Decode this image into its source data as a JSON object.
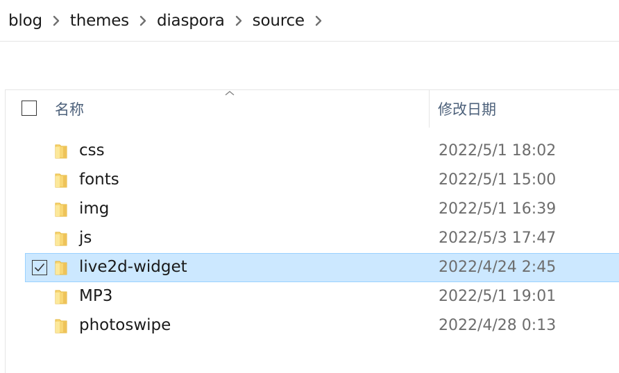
{
  "breadcrumb": {
    "items": [
      {
        "label": "blog"
      },
      {
        "label": "themes"
      },
      {
        "label": "diaspora"
      },
      {
        "label": "source"
      }
    ]
  },
  "header": {
    "name_label": "名称",
    "date_label": "修改日期",
    "sort_icon": "chevron-up-icon"
  },
  "colors": {
    "selected_bg": "#cce8ff",
    "selected_border": "#99d1ff",
    "folder": "#f8d775",
    "header_text": "#4c607a",
    "date_text": "#6d6d6d"
  },
  "files": [
    {
      "name": "css",
      "modified": "2022/5/1 18:02",
      "icon": "folder-icon",
      "selected": false
    },
    {
      "name": "fonts",
      "modified": "2022/5/1 15:00",
      "icon": "folder-icon",
      "selected": false
    },
    {
      "name": "img",
      "modified": "2022/5/1 16:39",
      "icon": "folder-icon",
      "selected": false
    },
    {
      "name": "js",
      "modified": "2022/5/3 17:47",
      "icon": "folder-icon",
      "selected": false
    },
    {
      "name": "live2d-widget",
      "modified": "2022/4/24 2:45",
      "icon": "folder-icon",
      "selected": true
    },
    {
      "name": "MP3",
      "modified": "2022/5/1 19:01",
      "icon": "folder-icon",
      "selected": false
    },
    {
      "name": "photoswipe",
      "modified": "2022/4/28 0:13",
      "icon": "folder-icon",
      "selected": false
    }
  ]
}
